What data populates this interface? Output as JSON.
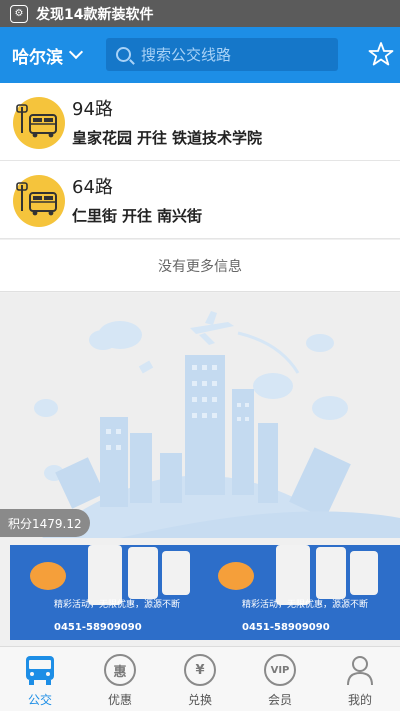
{
  "status_bar": {
    "notification": "发现14款新装软件"
  },
  "header": {
    "city": "哈尔滨",
    "search_placeholder": "搜索公交线路"
  },
  "routes": [
    {
      "name": "94路",
      "from": "皇家花园",
      "connector": "开往",
      "to": "铁道技术学院"
    },
    {
      "name": "64路",
      "from": "仁里街",
      "connector": "开往",
      "to": "南兴街"
    }
  ],
  "no_more": "没有更多信息",
  "points": "积分1479.12",
  "ads": [
    {
      "slogan": "精彩活动，无限优惠，源源不断",
      "hotline": "0451-58909090"
    },
    {
      "slogan": "精彩活动，无限优惠，源源不断",
      "hotline": "0451-58909090"
    }
  ],
  "tabs": [
    {
      "label": "公交",
      "icon": "bus-icon",
      "active": true
    },
    {
      "label": "优惠",
      "icon_text": "惠"
    },
    {
      "label": "兑换",
      "icon_text": "¥"
    },
    {
      "label": "会员",
      "icon_text": "VIP"
    },
    {
      "label": "我的",
      "icon": "person-icon"
    }
  ],
  "colors": {
    "primary": "#1d8ee6",
    "badge": "#f5c43c",
    "ad_bg": "#2d6ec9"
  }
}
